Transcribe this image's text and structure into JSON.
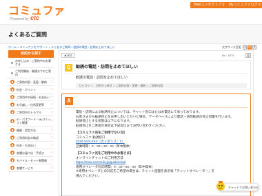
{
  "header": {
    "logo": "コミュファ",
    "logo_sub": "Powered by",
    "logo_brand": "ctc",
    "buttons": [
      "Webコンタクトフォーム",
      "Myコミュファログイン"
    ]
  },
  "page_title": "よくあるご質問",
  "breadcrumb": "ホーム > コミュファ光 サポート > よくあるご質問 > 勧誘の電話・訪問を止めてほしい",
  "font_size": {
    "label": "文字サイズ変更",
    "options": [
      "小",
      "中",
      "大"
    ],
    "selected": "中"
  },
  "sidebar": {
    "heading": "目的から探す",
    "items": [
      {
        "label": "お申し込み・ご契約中のお客さま",
        "type": "dot"
      },
      {
        "label": "ご利用開始・開通までのご案内",
        "type": "dot"
      },
      {
        "label": "ご契約内容・変更・解約",
        "type": "icon"
      },
      {
        "label": "料金・ポイント",
        "type": "icon"
      },
      {
        "label": "ご利用中の接続・お支払い",
        "type": "icon"
      },
      {
        "label": "お引越し・住所変更等",
        "type": "icon"
      },
      {
        "label": "ご利用中のトラブル",
        "type": "icon"
      },
      {
        "label": "ID・パスワード・Myコミュファ関連",
        "type": "icon"
      },
      {
        "label": "機器・設定方法",
        "type": "icon"
      },
      {
        "label": "ご利用料金の確認",
        "type": "icon"
      },
      {
        "label": "料金・お支払い",
        "type": "icon"
      },
      {
        "label": "各種お届け出・手続き",
        "type": "icon"
      },
      {
        "label": "モバイル・セット割関連",
        "type": "icon"
      },
      {
        "label": "各種サービス",
        "type": "icon"
      }
    ]
  },
  "main": {
    "back_label": "戻る",
    "question_number": "No : 1873",
    "question": {
      "badge": "Q",
      "title": "勧誘の電話・訪問を止めてほしい",
      "text": "勧誘の電話・訪問を止めてほしい",
      "category": "カテゴリー： 目的から探す > ご契約内容・変更・解約 > ご契約内容"
    },
    "answer": {
      "badge": "A",
      "paragraphs": [
        "電話・訪問による勧誘停止については、チャット窓口またはお電話にて承っております。",
        "お客さまから勧誘停止をお申し出いただいた場合、データベースにより電話・訪問勧誘の停止措置を行います。",
        "勧誘停止とする状態は以下になります。",
        "勧誘停止をご希望の場合は下記窓口までお問い合わせください。"
      ],
      "section1_title": "【コミュファ光をご利用でない方】",
      "section1_lines": [
        "コミュファ 勧誘窓口",
        "0120-XXX-XXX（ガイダンス：1）",
        "営業時間：9：00～18：00（年中無休）"
      ],
      "section2_title": "【コミュファ光をご利用中のお客さま】",
      "section2_lines": [
        "オンラインチャットのご利用方法",
        "https://www.commufa.jp/guide/chat/",
        "専用オペレータ対応時間：9：00～20：00（年中無休）",
        "※専用オペレータとの対応をご希望の場合は、チャット画面を表示後「チャットオペレーター」を",
        "選んでください。"
      ]
    },
    "chat_label": "チャットでお問い合わせ"
  },
  "colors": {
    "brand": "#f07a1a",
    "question": "#f2c41a",
    "link": "#1a62b3"
  }
}
